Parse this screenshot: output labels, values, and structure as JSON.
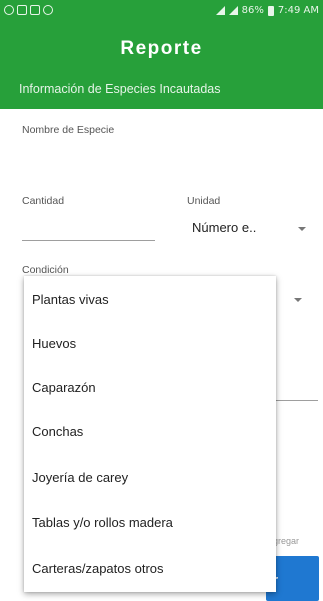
{
  "status_bar": {
    "right_text": "86%",
    "time": "7:49 AM"
  },
  "header": {
    "title": "Reporte",
    "subtitle": "Información de Especies Incautadas"
  },
  "form": {
    "species_label": "Nombre de Especie",
    "species_value": "",
    "quantity_label": "Cantidad",
    "quantity_value": "",
    "unit_label": "Unidad",
    "unit_value": "Número e..",
    "condition_label": "Condición",
    "add_label": "agregar",
    "save_label": "r"
  },
  "dropdown": {
    "options": [
      "Plantas vivas",
      "Huevos",
      "Caparazón",
      "Conchas",
      "Joyería de carey",
      "Tablas y/o rollos madera",
      "Carteras/zapatos otros"
    ]
  },
  "colors": {
    "header_green": "#27a03a",
    "button_blue": "#1f78d1"
  }
}
